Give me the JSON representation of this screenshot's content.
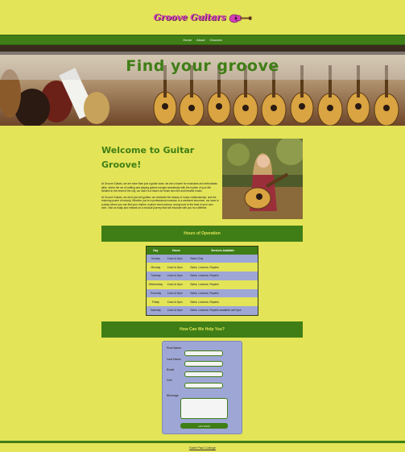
{
  "brand": {
    "logo_text": "Groove Guitars",
    "accent": "#3f7e16",
    "background": "#e3e457",
    "logo_color": "#d63fb8"
  },
  "nav": {
    "items": [
      "Home",
      "About",
      "Grooves"
    ]
  },
  "hero": {
    "title": "Find your groove"
  },
  "welcome": {
    "title": "Welcome to Guitar Groove!",
    "paragraph1": "At Groove Guitars, we are more than just a guitar store; we are a haven for musicians and enthusiasts alike, where the art of crafting and playing guitars merges seamlessly with the rhythm of your life. Nestled in the heart of the city, our store is a haven for those who live and breathe music.",
    "paragraph2": "At Groove Guitars, we don't just sell guitars; we celebrate the beauty of music craftsmanship, and the enduring power of melody. Whether you're a professional musician or a weekend strummer, our store is a place where you can find your rhythm, explore new horizons, and groove to the beat of your own tune. Visit us today and embark on a musical journey that will resonate with you for a lifetime."
  },
  "hours_section": {
    "title": "Hours of Operation",
    "headers": [
      "Day",
      "Hours",
      "Services Available"
    ],
    "rows": [
      {
        "day": "Sunday",
        "hours": "11am to 5pm",
        "services": "Sales Only"
      },
      {
        "day": "Monday",
        "hours": "11am to 5pm",
        "services": "Sales, Lessons, Repairs"
      },
      {
        "day": "Tuesday",
        "hours": "11am to 5pm",
        "services": "Sales, Lessons, Repairs"
      },
      {
        "day": "Wednesday",
        "hours": "11am to 5pm",
        "services": "Sales, Lessons, Repairs"
      },
      {
        "day": "Thursday",
        "hours": "11am to 5pm",
        "services": "Sales, Lessons, Repairs"
      },
      {
        "day": "Friday",
        "hours": "11am to 5pm",
        "services": "Sales, Lessons, Repairs"
      },
      {
        "day": "Saturday",
        "hours": "11am to 5pm",
        "services": "Sales, Lessons, Repairs available until 3pm"
      }
    ]
  },
  "help_section": {
    "title": "How Can We Help You?"
  },
  "form": {
    "first_name_label": "First Name",
    "last_name_label": "Last Name",
    "email_label": "Email",
    "cell_label": "Cell",
    "message_label": "Message",
    "submit_label": "Let's Rock!"
  },
  "footer": {
    "text": "Saint Paul College"
  }
}
